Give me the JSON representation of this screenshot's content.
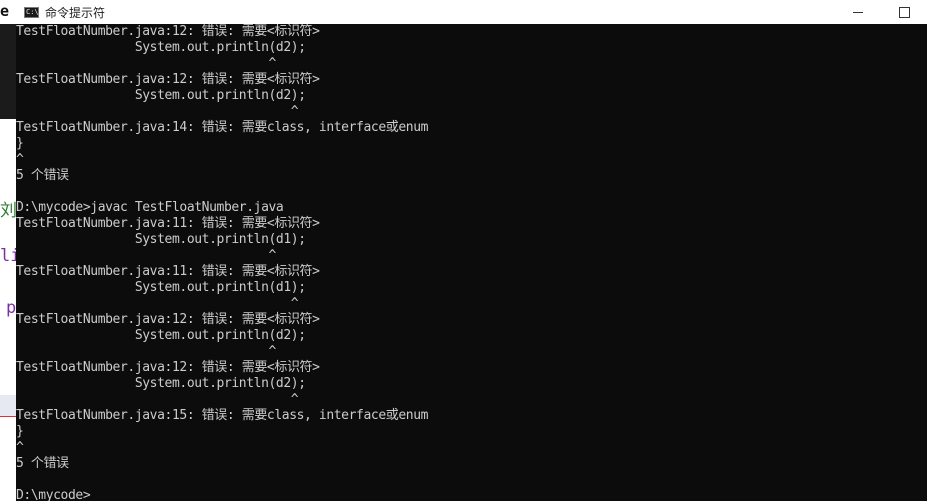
{
  "window": {
    "title": "命令提示符",
    "icon": "cmd-icon",
    "icon_text": "C:\\",
    "controls": [
      "minimize-icon",
      "maximize-icon"
    ]
  },
  "background_editor": {
    "glyphs": [
      "e",
      "刘",
      "li",
      "p"
    ]
  },
  "console": {
    "lines": [
      "TestFloatNumber.java:12: 错误: 需要<标识符>",
      "                System.out.println(d2);",
      "                                  ^",
      "TestFloatNumber.java:12: 错误: 需要<标识符>",
      "                System.out.println(d2);",
      "                                     ^",
      "TestFloatNumber.java:14: 错误: 需要class, interface或enum",
      "}",
      "^",
      "5 个错误",
      "",
      "D:\\mycode>javac TestFloatNumber.java",
      "TestFloatNumber.java:11: 错误: 需要<标识符>",
      "                System.out.println(d1);",
      "                                  ^",
      "TestFloatNumber.java:11: 错误: 需要<标识符>",
      "                System.out.println(d1);",
      "                                     ^",
      "TestFloatNumber.java:12: 错误: 需要<标识符>",
      "                System.out.println(d2);",
      "                                  ^",
      "TestFloatNumber.java:12: 错误: 需要<标识符>",
      "                System.out.println(d2);",
      "                                     ^",
      "TestFloatNumber.java:15: 错误: 需要class, interface或enum",
      "}",
      "^",
      "5 个错误",
      "",
      "D:\\mycode>"
    ]
  }
}
